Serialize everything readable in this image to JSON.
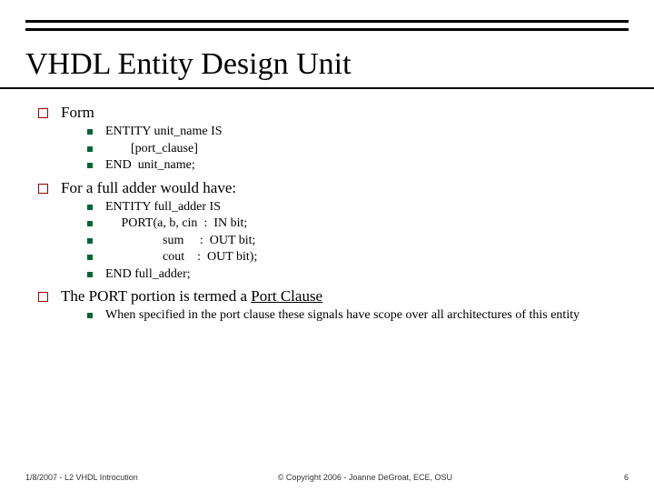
{
  "title": "VHDL Entity Design Unit",
  "sections": [
    {
      "heading": "Form",
      "items": [
        "ENTITY unit_name IS",
        "        [port_clause]",
        "END  unit_name;"
      ]
    },
    {
      "heading": "For a full adder would have:",
      "items": [
        "ENTITY full_adder IS",
        "     PORT(a, b, cin  :  IN bit;",
        "                  sum     :  OUT bit;",
        "                  cout    :  OUT bit);",
        "END full_adder;"
      ]
    },
    {
      "heading_pre": "The PORT portion is termed a ",
      "heading_underlined": "Port Clause",
      "items_wrap": [
        "When specified in the port clause these signals have scope over all architectures of this entity"
      ]
    }
  ],
  "footer": {
    "left": "1/8/2007 - L2 VHDL Introcution",
    "center": "© Copyright 2006 - Joanne DeGroat, ECE, OSU",
    "page": "6"
  }
}
